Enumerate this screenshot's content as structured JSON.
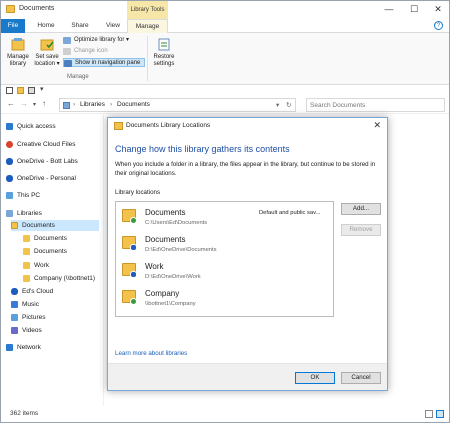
{
  "window": {
    "title": "Documents",
    "context_tab_group": "Library Tools",
    "controls": {
      "minimize": "—",
      "maximize": "☐",
      "close": "✕"
    }
  },
  "ribbon_tabs": [
    "File",
    "Home",
    "Share",
    "View",
    "Manage"
  ],
  "ribbon": {
    "manage_library": "Manage\nlibrary",
    "manage_library_l1": "Manage",
    "manage_library_l2": "library",
    "set_save_location_l1": "Set save",
    "set_save_location_l2": "location ▾",
    "optimize_library": "Optimize library for ▾",
    "change_icon": "Change icon",
    "show_in_nav_pane": "Show in navigation pane",
    "restore_settings_l1": "Restore",
    "restore_settings_l2": "settings",
    "group_label": "Manage"
  },
  "quick_access_toolbar": {
    "dropdown": "▾"
  },
  "address": {
    "back": "←",
    "forward": "→",
    "dropdown": "▾",
    "up": "↑",
    "crumbs": [
      "Libraries",
      "Documents"
    ],
    "separator": "›",
    "refresh": "↻",
    "search_placeholder": "Search Documents"
  },
  "nav_pane": {
    "items": [
      {
        "label": "Quick access",
        "icon": "star-icon"
      },
      {
        "label": "Creative Cloud Files",
        "icon": "creative-cloud-icon"
      },
      {
        "label": "OneDrive - Bott Labs",
        "icon": "onedrive-icon"
      },
      {
        "label": "OneDrive - Personal",
        "icon": "onedrive-icon"
      },
      {
        "label": "This PC",
        "icon": "pc-icon"
      },
      {
        "label": "Libraries",
        "icon": "libraries-icon"
      },
      {
        "label": "Documents",
        "icon": "documents-icon"
      },
      {
        "label": "Documents",
        "icon": "folder-icon"
      },
      {
        "label": "Documents",
        "icon": "folder-icon"
      },
      {
        "label": "Work",
        "icon": "folder-icon"
      },
      {
        "label": "Company (\\\\bottnet1)",
        "icon": "folder-icon"
      },
      {
        "label": "Ed's Cloud",
        "icon": "cloud-icon"
      },
      {
        "label": "Music",
        "icon": "music-icon"
      },
      {
        "label": "Pictures",
        "icon": "pictures-icon"
      },
      {
        "label": "Videos",
        "icon": "videos-icon"
      },
      {
        "label": "Network",
        "icon": "network-icon"
      }
    ]
  },
  "status_bar": {
    "count": "362 items"
  },
  "dialog": {
    "title": "Documents Library Locations",
    "close": "✕",
    "heading": "Change how this library gathers its contents",
    "description": "When you include a folder in a library, the files appear in the library, but continue to be stored in their original locations.",
    "list_label": "Library locations",
    "locations": [
      {
        "name": "Documents",
        "path": "C:\\Users\\Ed\\Documents",
        "note": "Default and public sav...",
        "badge": "check"
      },
      {
        "name": "Documents",
        "path": "D:\\Ed\\OneDrive\\Documents",
        "note": "",
        "badge": "cloud"
      },
      {
        "name": "Work",
        "path": "D:\\Ed\\OneDrive\\Work",
        "note": "",
        "badge": "cloud"
      },
      {
        "name": "Company",
        "path": "\\\\bottnet1\\Company",
        "note": "",
        "badge": "share"
      }
    ],
    "add_button": "Add...",
    "remove_button": "Remove",
    "learn_more": "Learn more about libraries",
    "ok_button": "OK",
    "cancel_button": "Cancel"
  }
}
